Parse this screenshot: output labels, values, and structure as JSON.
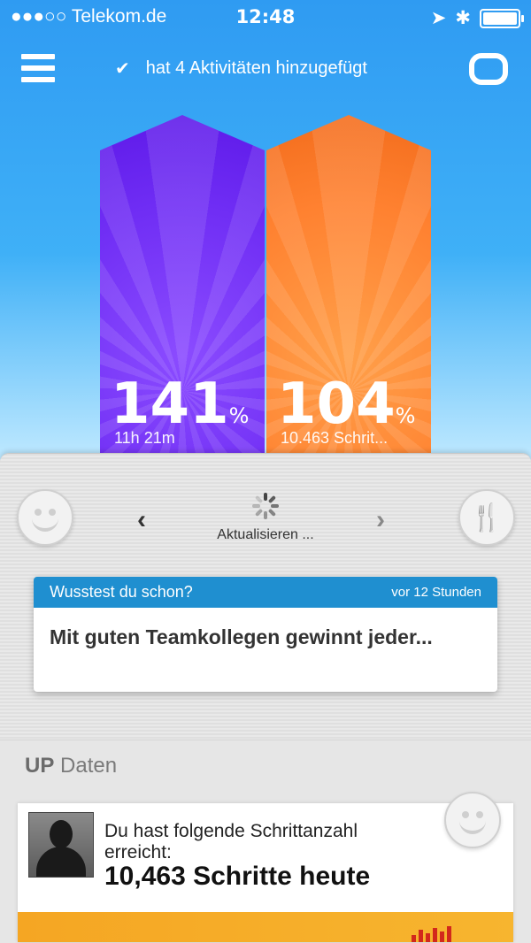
{
  "status_bar": {
    "carrier": "●●●○○ Telekom.de",
    "time": "12:48"
  },
  "header": {
    "notice": "hat 4 Aktivitäten hinzugefügt"
  },
  "goals": {
    "sleep": {
      "percent": "141",
      "unit": "%",
      "value": "11h 21m",
      "color": "#6f2df4"
    },
    "steps": {
      "percent": "104",
      "unit": "%",
      "value": "10.463 Schrit...",
      "color": "#ff8130"
    }
  },
  "navigator": {
    "status": "Aktualisieren ..."
  },
  "tip_card": {
    "title": "Wusstest du schon?",
    "age": "vor 12 Stunden",
    "text": "Mit guten Teamkollegen gewinnt jeder..."
  },
  "up_section": {
    "brand": "UP",
    "title": "Daten"
  },
  "feed_item": {
    "line1": "Du hast folgende Schrittanzahl erreicht:",
    "line2": "10,463 Schritte heute"
  },
  "icons": [
    "wifi-icon",
    "location-arrow-icon",
    "bluetooth-icon",
    "battery-icon",
    "menu-icon",
    "check-icon",
    "chat-icon",
    "mood-smiley-icon",
    "fork-knife-icon",
    "chevron-left-icon",
    "chevron-right-icon",
    "spinner-icon"
  ]
}
